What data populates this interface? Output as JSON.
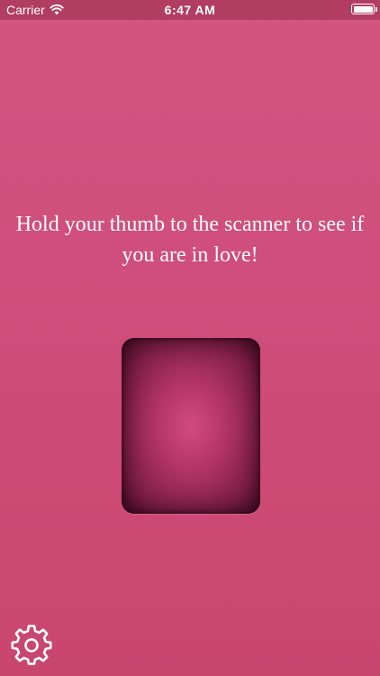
{
  "status_bar": {
    "carrier": "Carrier",
    "time": "6:47 AM"
  },
  "main": {
    "instruction": "Hold your thumb to the scanner to see if you are in love!"
  },
  "icons": {
    "wifi": "wifi-icon",
    "battery": "battery-icon",
    "settings": "gear-icon"
  },
  "colors": {
    "background": "#cf4e7b",
    "status_bar": "#b13d62",
    "scanner_dark": "#4a0f27",
    "text": "#ffffff"
  }
}
